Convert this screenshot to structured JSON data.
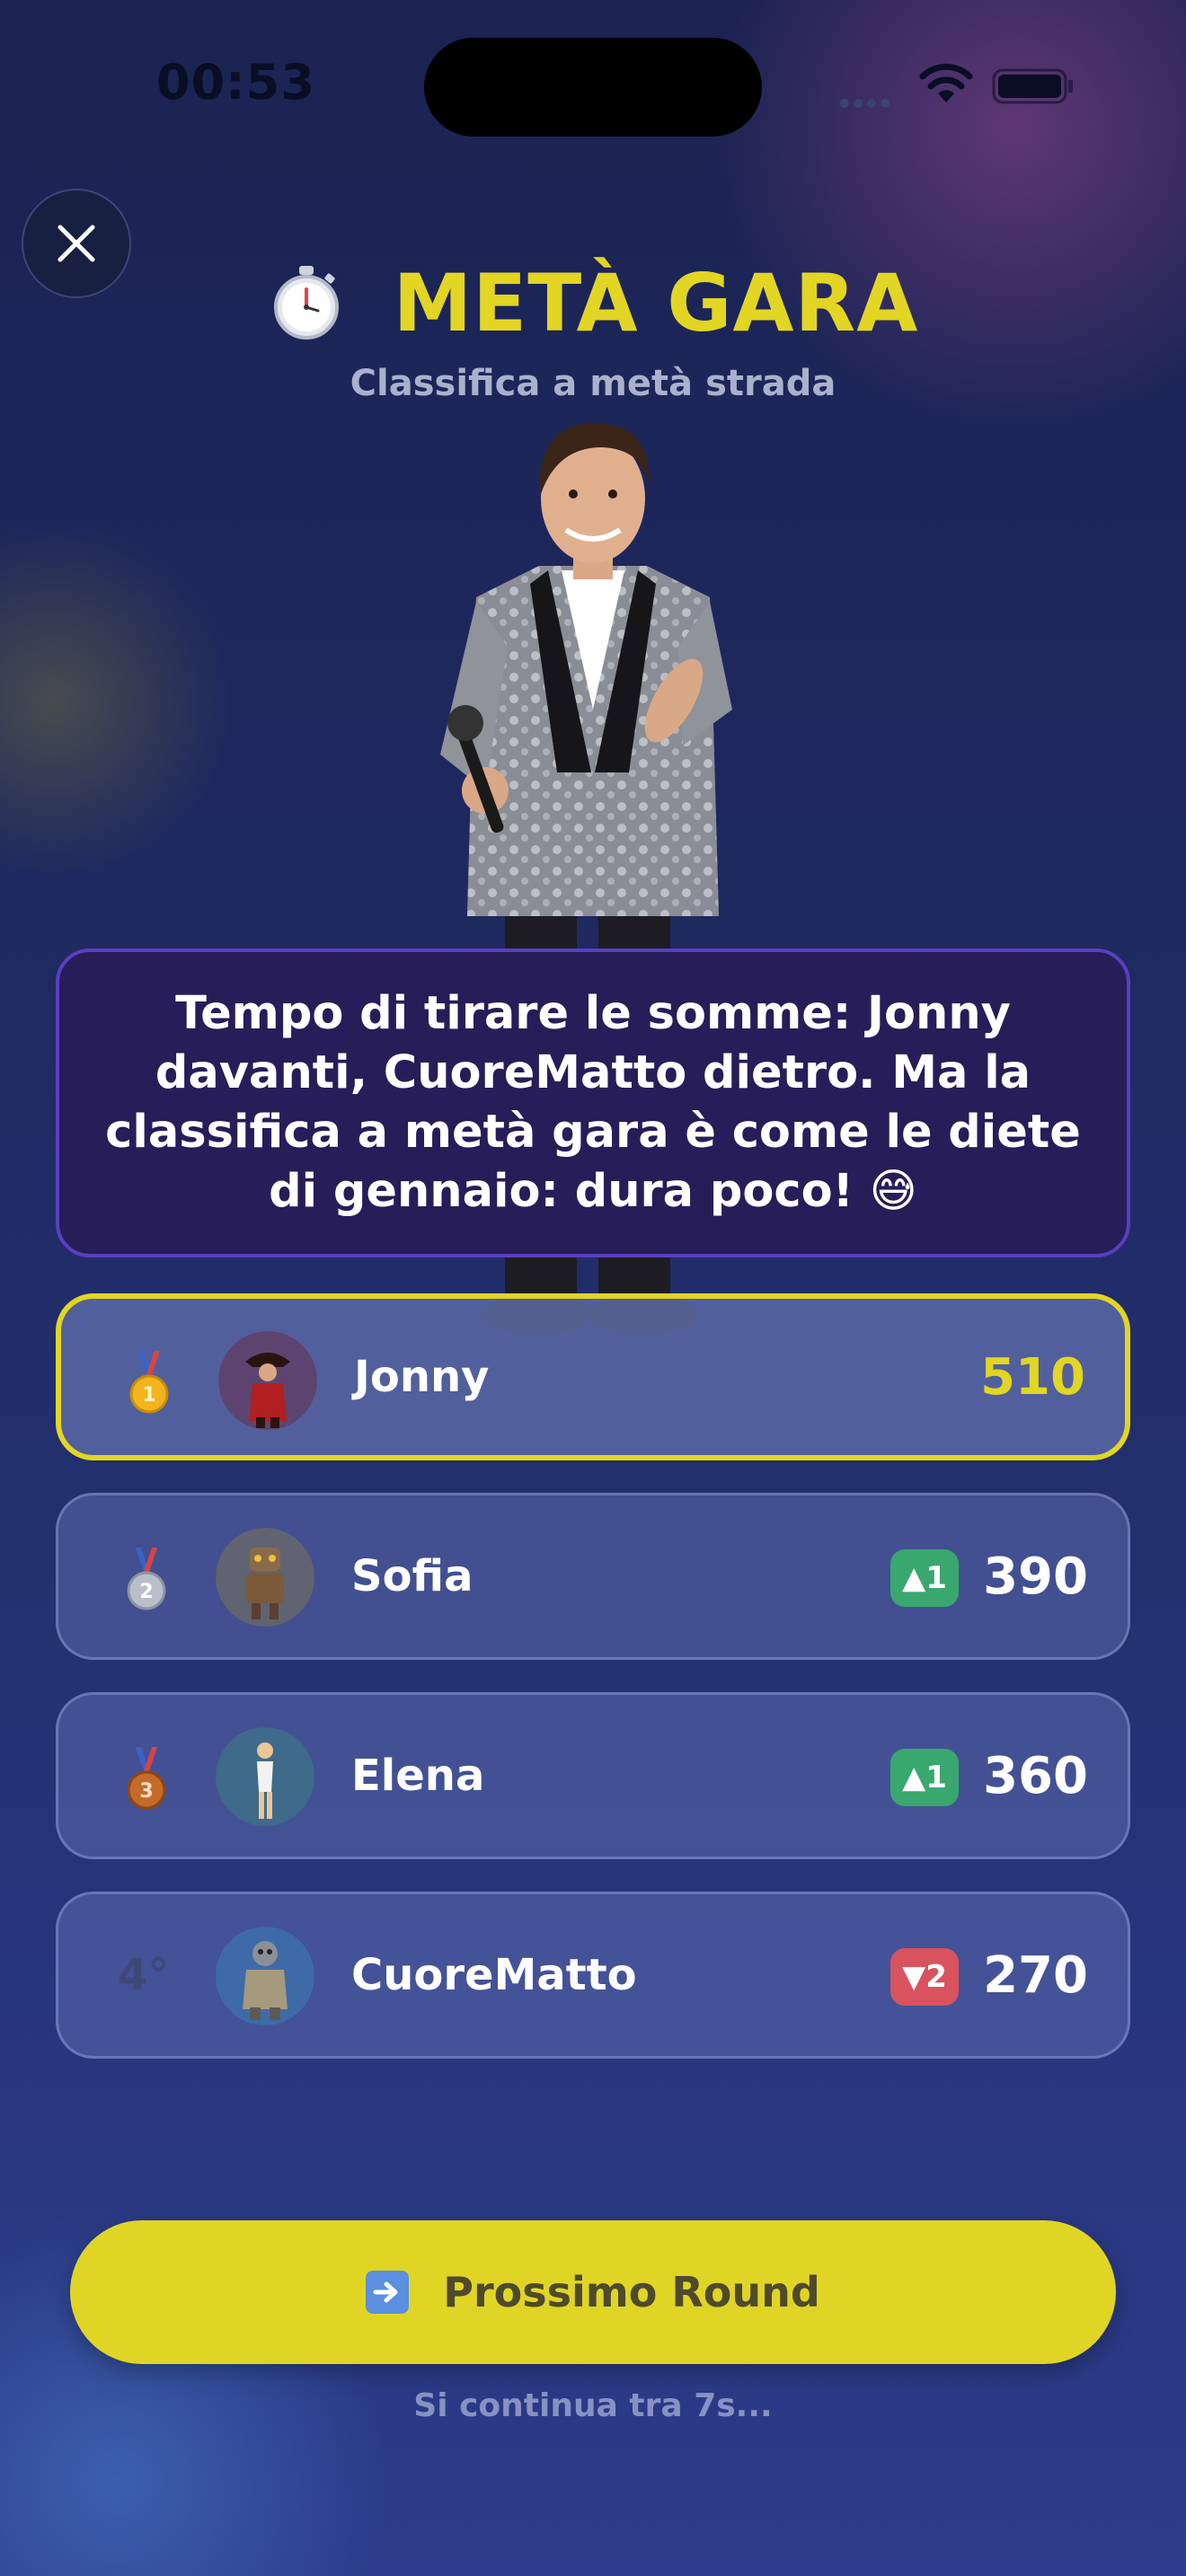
{
  "status_bar": {
    "time": "00:53"
  },
  "header": {
    "title": "METÀ GARA",
    "subtitle": "Classifica a metà strada"
  },
  "host": {
    "speech": "Tempo di tirare le somme: Jonny davanti, CuoreMatto dietro. Ma la classifica a metà gara è come le diete di gennaio: dura poco! 😅"
  },
  "leaderboard": [
    {
      "rank": 1,
      "name": "Jonny",
      "score": "510",
      "medal": "gold"
    },
    {
      "rank": 2,
      "name": "Sofia",
      "score": "390",
      "medal": "silver",
      "change": "▲1",
      "direction": "up"
    },
    {
      "rank": 3,
      "name": "Elena",
      "score": "360",
      "medal": "bronze",
      "change": "▲1",
      "direction": "up"
    },
    {
      "rank": 4,
      "rank_label": "4°",
      "name": "CuoreMatto",
      "score": "270",
      "change": "▼2",
      "direction": "down"
    }
  ],
  "actions": {
    "next_label": "Prossimo Round",
    "countdown": "Si continua tra 7s..."
  },
  "colors": {
    "accent_yellow": "#e2d523",
    "speech_bg": "#271d59",
    "speech_border": "#5a3fbf",
    "up_green": "#3aa76e",
    "down_red": "#d9535e",
    "background": "#1f2a62"
  }
}
